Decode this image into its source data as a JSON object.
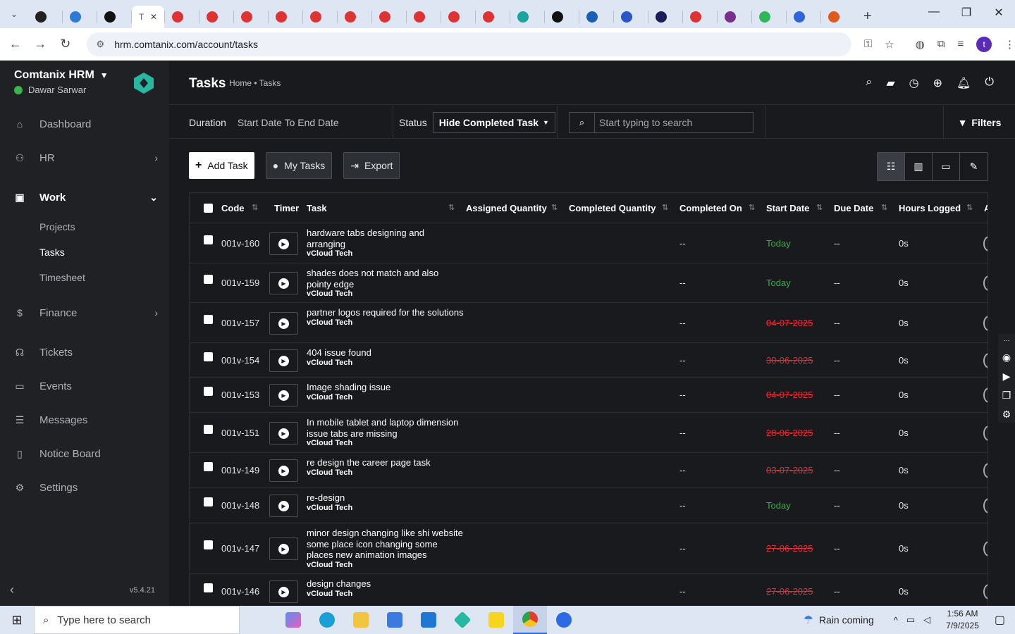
{
  "browser": {
    "active_tab_letter": "T",
    "url": "hrm.comtanix.com/account/tasks",
    "profile_initial": "t"
  },
  "sidebar": {
    "brand": "Comtanix HRM",
    "user": "Dawar Sarwar",
    "items": [
      {
        "label": "Dashboard",
        "icon": "home-icon"
      },
      {
        "label": "HR",
        "icon": "users-icon"
      },
      {
        "label": "Work",
        "icon": "briefcase-icon"
      },
      {
        "label": "Finance",
        "icon": "dollar-icon"
      },
      {
        "label": "Tickets",
        "icon": "headset-icon"
      },
      {
        "label": "Events",
        "icon": "calendar-icon"
      },
      {
        "label": "Messages",
        "icon": "message-icon"
      },
      {
        "label": "Notice Board",
        "icon": "clipboard-icon"
      },
      {
        "label": "Settings",
        "icon": "gear-icon"
      }
    ],
    "work_sub": [
      "Projects",
      "Tasks",
      "Timesheet"
    ],
    "version": "v5.4.21",
    "accent": "#39b54a"
  },
  "header": {
    "title": "Tasks",
    "breadcrumb": "Home • Tasks"
  },
  "filters": {
    "duration_label": "Duration",
    "duration_value": "Start Date To End Date",
    "status_label": "Status",
    "status_value": "Hide Completed Task",
    "search_placeholder": "Start typing to search",
    "filters_label": "Filters"
  },
  "actions": {
    "add_task": "Add Task",
    "my_tasks": "My Tasks",
    "export": "Export"
  },
  "table": {
    "columns": {
      "code": "Code",
      "timer": "Timer",
      "task": "Task",
      "assigned_qty": "Assigned Quantity",
      "completed_qty": "Completed Quantity",
      "completed_on": "Completed On",
      "start_date": "Start Date",
      "due_date": "Due Date",
      "hours_logged": "Hours Logged",
      "partial": "A"
    },
    "rows": [
      {
        "code": "001v-160",
        "task": "hardware tabs designing and arranging",
        "project": "vCloud Tech",
        "completed_on": "--",
        "start_date": "Today",
        "status": "green",
        "due_date": "--",
        "hours": "0s"
      },
      {
        "code": "001v-159",
        "task": "shades does not match and also pointy edge",
        "project": "vCloud Tech",
        "completed_on": "--",
        "start_date": "Today",
        "status": "green",
        "due_date": "--",
        "hours": "0s"
      },
      {
        "code": "001v-157",
        "task": "partner logos required for the solutions",
        "project": "vCloud Tech",
        "completed_on": "--",
        "start_date": "04-07-2025",
        "status": "red",
        "due_date": "--",
        "hours": "0s"
      },
      {
        "code": "001v-154",
        "task": "404 issue found",
        "project": "vCloud Tech",
        "completed_on": "--",
        "start_date": "30-06-2025",
        "status": "red",
        "due_date": "--",
        "hours": "0s"
      },
      {
        "code": "001v-153",
        "task": "Image shading issue",
        "project": "vCloud Tech",
        "completed_on": "--",
        "start_date": "04-07-2025",
        "status": "red",
        "due_date": "--",
        "hours": "0s"
      },
      {
        "code": "001v-151",
        "task": "In mobile tablet and laptop dimension issue tabs are missing",
        "project": "vCloud Tech",
        "completed_on": "--",
        "start_date": "28-06-2025",
        "status": "red",
        "due_date": "--",
        "hours": "0s"
      },
      {
        "code": "001v-149",
        "task": "re design the career page task",
        "project": "vCloud Tech",
        "completed_on": "--",
        "start_date": "03-07-2025",
        "status": "red",
        "due_date": "--",
        "hours": "0s"
      },
      {
        "code": "001v-148",
        "task": "re-design",
        "project": "vCloud Tech",
        "completed_on": "--",
        "start_date": "Today",
        "status": "green",
        "due_date": "--",
        "hours": "0s"
      },
      {
        "code": "001v-147",
        "task": "minor design changing like shi website some place icon changing some places new animation images",
        "project": "vCloud Tech",
        "completed_on": "--",
        "start_date": "27-06-2025",
        "status": "red",
        "due_date": "--",
        "hours": "0s"
      },
      {
        "code": "001v-146",
        "task": "design changes",
        "project": "vCloud Tech",
        "completed_on": "--",
        "start_date": "27-06-2025",
        "status": "red",
        "due_date": "--",
        "hours": "0s"
      }
    ]
  },
  "taskbar": {
    "search_placeholder": "Type here to search",
    "weather": "Rain coming",
    "time": "1:56 AM",
    "date": "7/9/2025"
  }
}
